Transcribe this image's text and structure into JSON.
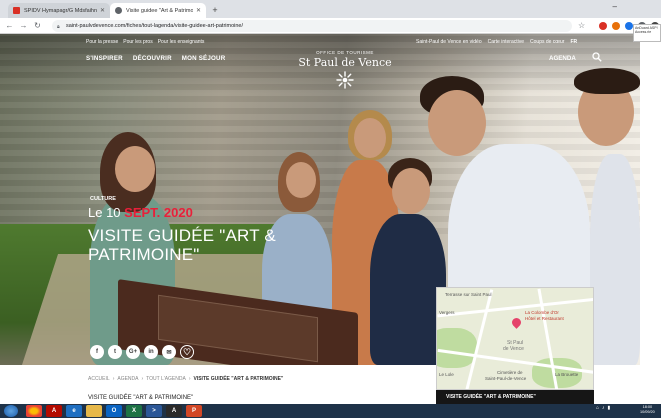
{
  "browser": {
    "tabs": [
      {
        "title": "SPIDV Hymapagr/G Mdsfaihn",
        "favicon_color": "#d93025"
      },
      {
        "title": "Visite guidee \"Art & Patrimoine\"",
        "favicon_color": "#5f6368"
      }
    ],
    "new_tab": "+",
    "minimize": "–",
    "url": "saint-paulvdevence.com/fiches/tout-lagenda/visite-guidee-art-patrimoine/",
    "profile_card": "AnDuard ASP! Access.rie"
  },
  "site": {
    "top_links_left": [
      "Pour la presse",
      "Pour les pros",
      "Pour les enseignants"
    ],
    "top_links_right": [
      "Saint-Paul de Vence en vidéo",
      "Carte interactive",
      "Coups de cœur",
      "FR"
    ],
    "main_nav": [
      "S'INSPIRER",
      "DÉCOUVRIR",
      "MON SÉJOUR"
    ],
    "agenda": "AGENDA",
    "logo_sub": "OFFICE DE TOURISME",
    "logo_name": "St Paul de Vence"
  },
  "event": {
    "category": "CULTURE",
    "date_prefix": "Le 10",
    "date_highlight": "SEPT. 2020",
    "title": "VISITE GUIDÉE \"ART & PATRIMOINE\""
  },
  "social": [
    "f",
    "t",
    "G+",
    "in",
    "✉",
    "♡"
  ],
  "map": {
    "labels": [
      "Terrasse sur Saint Paul",
      "La Colombe d'Or",
      "Hôtel et Restaurant",
      "St Paul",
      "de Vence",
      "Cimetière de",
      "Saint-Paul-de-Vence",
      "La Brouette",
      "Vergers",
      "Le Lole"
    ],
    "caption": "VISITE GUIDÉE \"ART & PATRIMOINE\""
  },
  "breadcrumb": [
    "ACCUEIL",
    "AGENDA",
    "TOUT L'AGENDA",
    "VISITE GUIDÉE \"ART & PATRIMOINE\""
  ],
  "subtitle": "VISITE GUIDÉE \"ART & PATRIMOINE\"",
  "taskbar": {
    "apps": [
      "Chrome",
      "Acrobat",
      "Edge",
      "Explorer",
      "Outlook",
      "Excel",
      "PowerShell",
      "PDF",
      "PowerPoint"
    ],
    "time": "18:00",
    "date": "10/09/20"
  },
  "colors": {
    "accent_red": "#e8203a",
    "map_pin": "#e5426a",
    "taskbar": "#1e3248"
  }
}
